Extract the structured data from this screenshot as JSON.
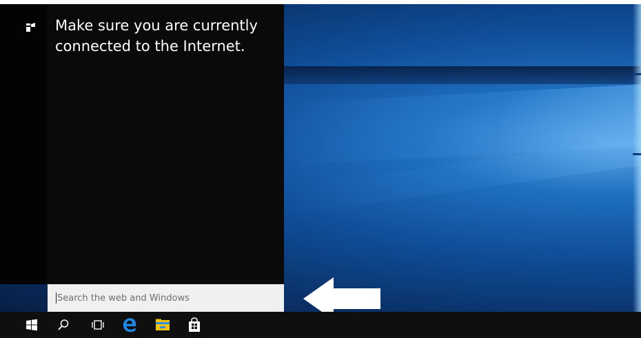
{
  "cortana": {
    "message": "Make sure you are currently connected to the Internet.",
    "search_placeholder": "Search the web and Windows"
  },
  "taskbar": {
    "items": [
      {
        "icon": "windows-start-icon"
      },
      {
        "icon": "search-icon"
      },
      {
        "icon": "task-view-icon"
      },
      {
        "icon": "edge-browser-icon"
      },
      {
        "icon": "file-explorer-icon"
      },
      {
        "icon": "store-icon"
      }
    ]
  },
  "colors": {
    "panel_bg": "#0a0a0a",
    "rail_bg": "#030303",
    "taskbar_bg": "#0f0f0f",
    "search_bg": "#f0f0f0",
    "edge_blue": "#1e88e5",
    "explorer_yellow": "#f4c20d"
  }
}
